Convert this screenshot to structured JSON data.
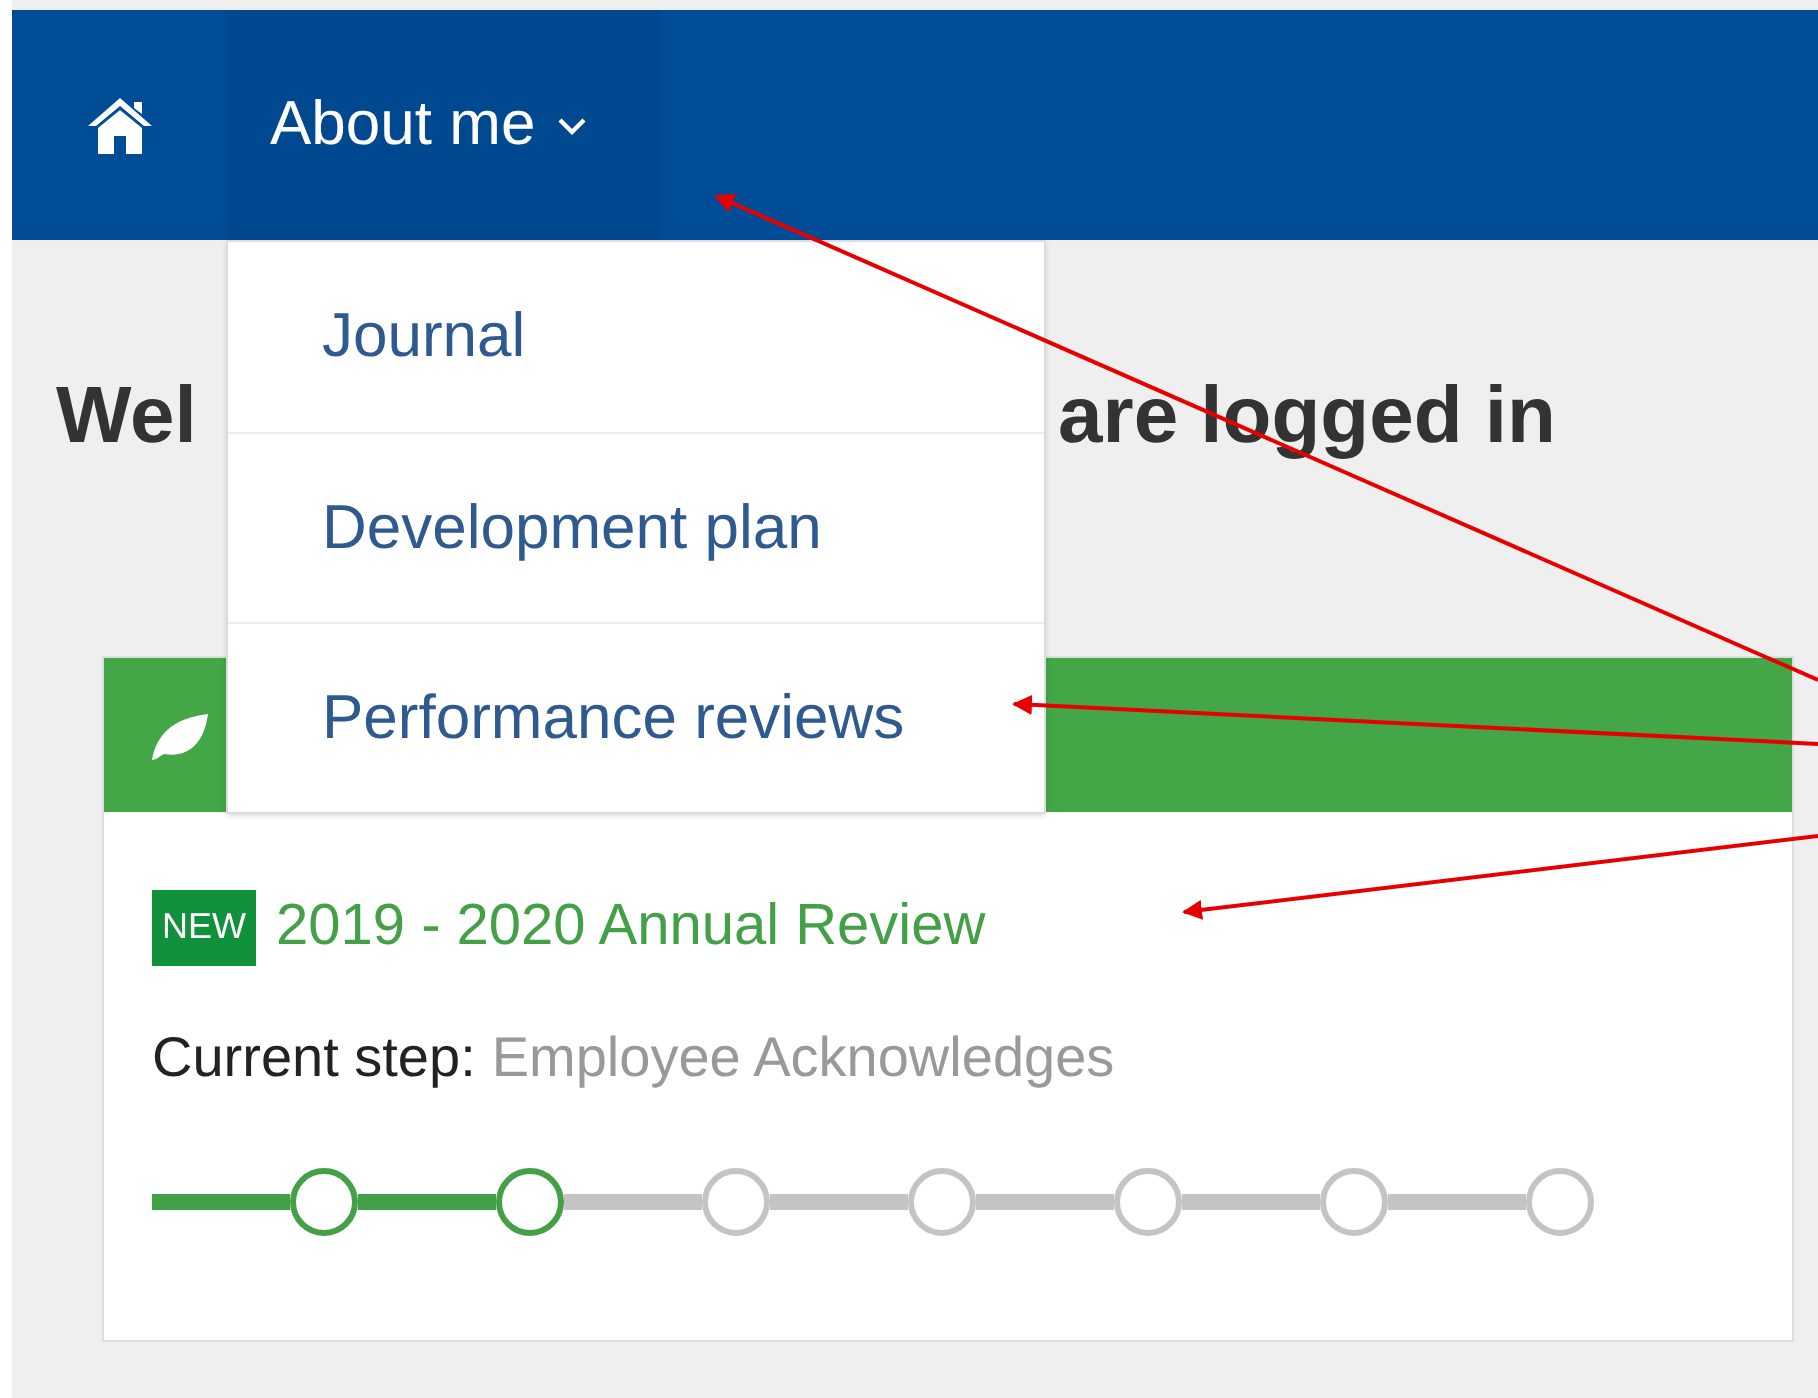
{
  "nav": {
    "menu": {
      "label": "About me",
      "expanded": true
    }
  },
  "dropdown": {
    "items": [
      {
        "label": "Journal"
      },
      {
        "label": "Development plan"
      },
      {
        "label": "Performance reviews"
      }
    ]
  },
  "heading": {
    "visible_start": "Wel",
    "visible_end": "are logged in"
  },
  "card": {
    "badge": "NEW",
    "title": "2019 - 2020 Annual Review",
    "step_label": "Current step:",
    "step_value": "Employee Acknowledges",
    "steps": [
      {
        "done": true
      },
      {
        "done": true
      },
      {
        "done": false
      },
      {
        "done": false
      },
      {
        "done": false
      },
      {
        "done": false
      },
      {
        "done": false
      }
    ]
  }
}
